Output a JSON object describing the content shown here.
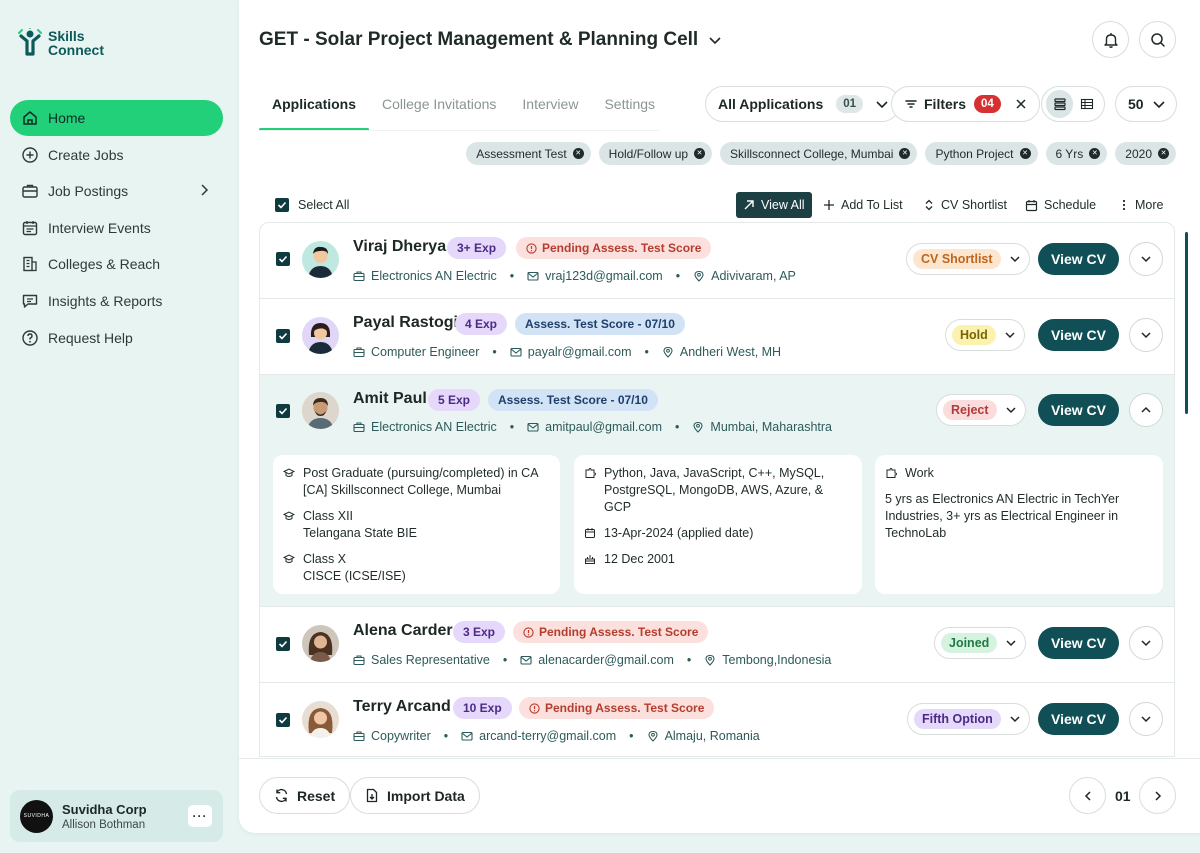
{
  "brand": {
    "line1": "Skills",
    "line2": "Connect"
  },
  "sidebar": {
    "items": [
      {
        "label": "Home",
        "icon": "home-icon",
        "active": true
      },
      {
        "label": "Create Jobs",
        "icon": "plus-circle-icon"
      },
      {
        "label": "Job Postings",
        "icon": "briefcase-icon",
        "has_children": true
      },
      {
        "label": "Interview Events",
        "icon": "calendar-icon"
      },
      {
        "label": "Colleges & Reach",
        "icon": "building-icon"
      },
      {
        "label": "Insights & Reports",
        "icon": "chat-icon"
      },
      {
        "label": "Request Help",
        "icon": "help-icon"
      }
    ]
  },
  "account": {
    "name": "Suvidha Corp",
    "user": "Allison Bothman",
    "logo_text": "SUVIDHA"
  },
  "header": {
    "title": "GET - Solar Project Management & Planning Cell"
  },
  "tabs": [
    "Applications",
    "College Invitations",
    "Interview",
    "Settings"
  ],
  "controls": {
    "view_select": "All Applications",
    "view_count": "01",
    "filters_label": "Filters",
    "filters_count": "04",
    "page_size": "50"
  },
  "chips": [
    "Assessment Test",
    "Hold/Follow up",
    "Skillsconnect College, Mumbai",
    "Python Project",
    "6 Yrs",
    "2020"
  ],
  "toolbar": {
    "select_all": "Select All",
    "view_all": "View All",
    "add_to_list": "Add To List",
    "cv_shortlist": "CV Shortlist",
    "schedule": "Schedule",
    "more": "More"
  },
  "candidates": [
    {
      "name": "Viraj Dherya",
      "exp": "3+ Exp",
      "tag": "Pending Assess. Test Score",
      "tag_type": "pending",
      "role": "Electronics AN Electric",
      "email": "vraj123d@gmail.com",
      "location": "Adivivaram, AP",
      "status": "CV Shortlist",
      "status_bg": "#fde6cf",
      "status_fg": "#c0651b"
    },
    {
      "name": "Payal Rastogi",
      "exp": "4 Exp",
      "tag": "Assess. Test Score - 07/10",
      "tag_type": "score",
      "role": "Computer Engineer",
      "email": "payalr@gmail.com",
      "location": "Andheri West, MH",
      "status": "Hold",
      "status_bg": "#fbf2b0",
      "status_fg": "#7a6500"
    },
    {
      "name": "Amit Paul",
      "exp": "5 Exp",
      "tag": "Assess. Test Score - 07/10",
      "tag_type": "score",
      "role": "Electronics AN Electric",
      "email": "amitpaul@gmail.com",
      "location": "Mumbai, Maharashtra",
      "status": "Reject",
      "status_bg": "#fbdcdc",
      "status_fg": "#b33a3a",
      "expanded": true
    },
    {
      "name": "Alena Carder",
      "exp": "3 Exp",
      "tag": "Pending Assess. Test Score",
      "tag_type": "pending",
      "role": "Sales Representative",
      "email": "alenacarder@gmail.com",
      "location": "Tembong,Indonesia",
      "status": "Joined",
      "status_bg": "#d6f3df",
      "status_fg": "#1f7a44"
    },
    {
      "name": "Terry Arcand",
      "exp": "10 Exp",
      "tag": "Pending Assess. Test Score",
      "tag_type": "pending",
      "role": "Copywriter",
      "email": "arcand-terry@gmail.com",
      "location": "Almaju, Romania",
      "status": "Fifth Option",
      "status_bg": "#e4d8fb",
      "status_fg": "#4b2b86"
    }
  ],
  "view_cv_label": "View CV",
  "details": {
    "education": [
      {
        "l1": "Post Graduate (pursuing/completed) in CA",
        "l2": "[CA] Skillsconnect College, Mumbai"
      },
      {
        "l1": "Class XII",
        "l2": "Telangana State BIE"
      },
      {
        "l1": "Class X",
        "l2": "CISCE (ICSE/ISE)"
      }
    ],
    "skills": "Python, Java, JavaScript, C++, MySQL, PostgreSQL, MongoDB, AWS, Azure, & GCP",
    "applied": "13-Apr-2024 (applied date)",
    "dob": "12 Dec 2001",
    "work_title": "Work",
    "work_text": "5 yrs as Electronics AN Electric in TechYer Industries, 3+ yrs as Electrical Engineer in TechnoLab"
  },
  "footer": {
    "reset": "Reset",
    "import": "Import Data",
    "page": "01"
  },
  "colors": {
    "accent": "#22d07a",
    "primary": "#0f4f55",
    "background": "#e7f4f1"
  }
}
